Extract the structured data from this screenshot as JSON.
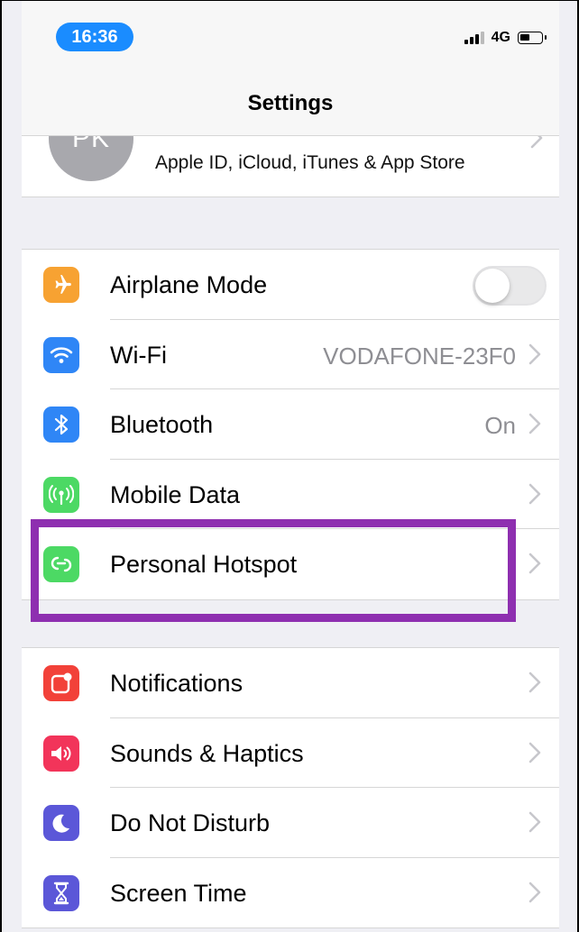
{
  "status_bar": {
    "time": "16:36",
    "network": "4G"
  },
  "nav": {
    "title": "Settings"
  },
  "apple_id": {
    "initials": "PK",
    "label": "Apple ID, iCloud, iTunes & App Store"
  },
  "connectivity": [
    {
      "label": "Airplane Mode",
      "icon": "airplane-icon",
      "color": "#f7a232",
      "control": "toggle",
      "toggle_on": false
    },
    {
      "label": "Wi-Fi",
      "icon": "wifi-icon",
      "color": "#2f86f6",
      "value": "VODAFONE-23F0"
    },
    {
      "label": "Bluetooth",
      "icon": "bluetooth-icon",
      "color": "#2f86f6",
      "value": "On"
    },
    {
      "label": "Mobile Data",
      "icon": "antenna-icon",
      "color": "#4cd964"
    },
    {
      "label": "Personal Hotspot",
      "icon": "hotspot-link-icon",
      "color": "#4cd964"
    }
  ],
  "general": [
    {
      "label": "Notifications",
      "icon": "notifications-icon",
      "color": "#f24139"
    },
    {
      "label": "Sounds & Haptics",
      "icon": "speaker-icon",
      "color": "#f2345a"
    },
    {
      "label": "Do Not Disturb",
      "icon": "moon-icon",
      "color": "#5b57d8"
    },
    {
      "label": "Screen Time",
      "icon": "hourglass-icon",
      "color": "#5b57d8"
    }
  ],
  "highlight_color": "#8e2fb0"
}
